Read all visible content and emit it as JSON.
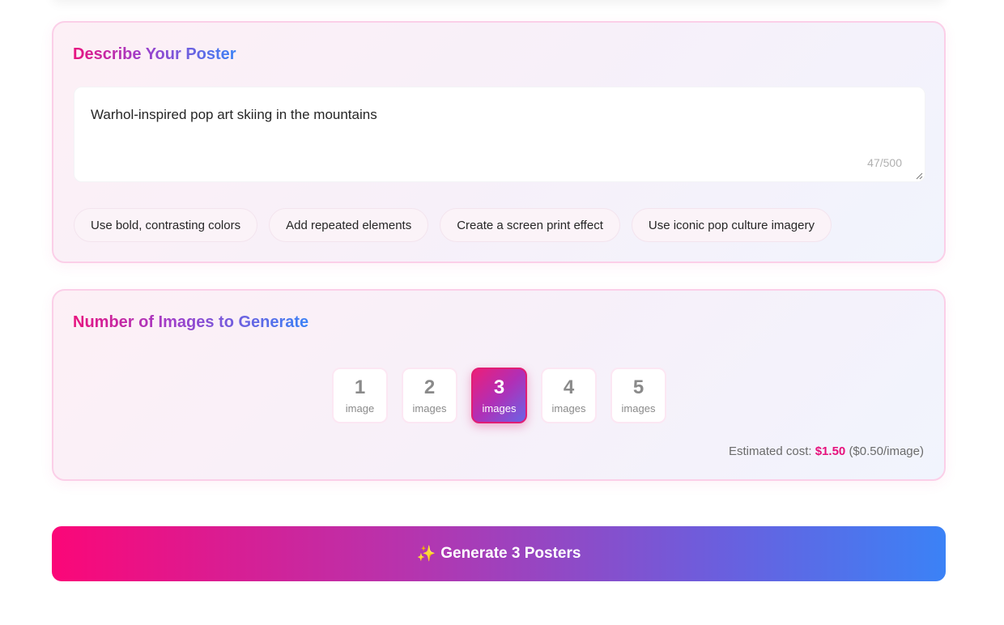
{
  "describe": {
    "title": "Describe Your Poster",
    "prompt_value": "Warhol-inspired pop art skiing in the mountains",
    "char_count": "47/500",
    "suggestions": [
      "Use bold, contrasting colors",
      "Add repeated elements",
      "Create a screen print effect",
      "Use iconic pop culture imagery"
    ]
  },
  "count": {
    "title": "Number of Images to Generate",
    "options": [
      {
        "num": "1",
        "unit": "image"
      },
      {
        "num": "2",
        "unit": "images"
      },
      {
        "num": "3",
        "unit": "images"
      },
      {
        "num": "4",
        "unit": "images"
      },
      {
        "num": "5",
        "unit": "images"
      }
    ],
    "selected": 3,
    "cost_label": "Estimated cost: ",
    "cost_amount": "$1.50",
    "cost_per": "($0.50/image)"
  },
  "generate": {
    "icon": "sparkles-icon",
    "icon_glyph": "✨",
    "label": "Generate 3 Posters"
  },
  "colors": {
    "accent_pink": "#e6117c",
    "accent_blue": "#3b82f6",
    "card_border": "#fbcfe8"
  }
}
